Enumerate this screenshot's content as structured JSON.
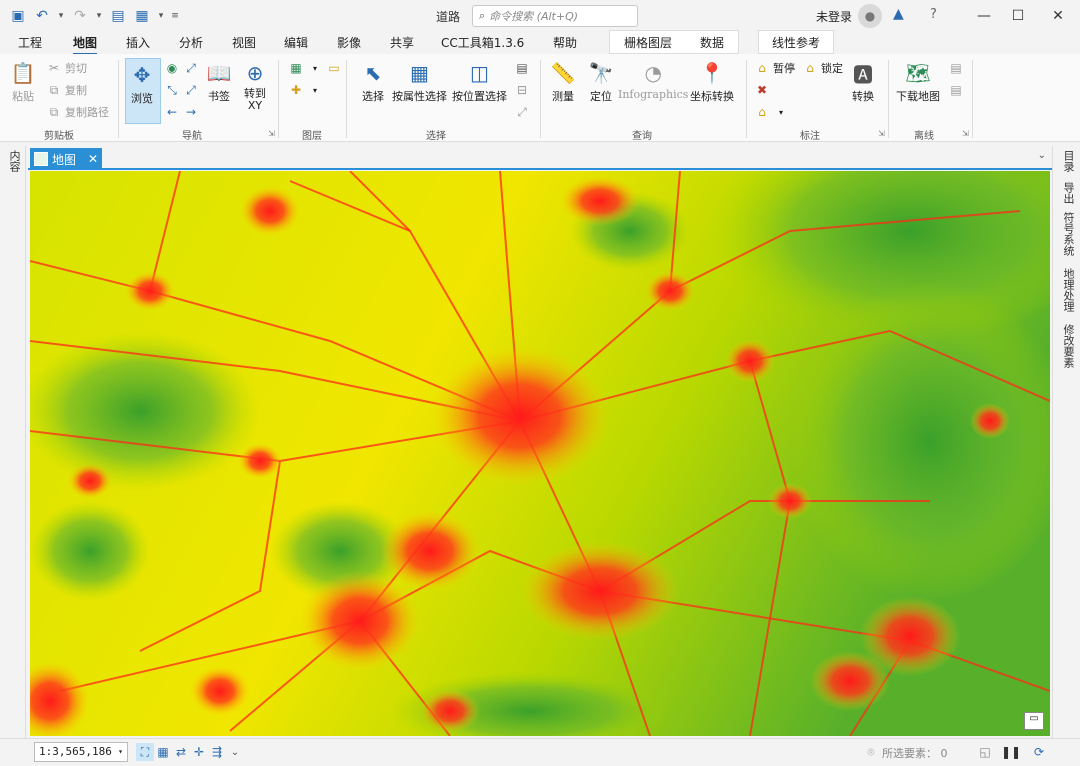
{
  "window": {
    "doc_title": "道路",
    "search_placeholder": "命令搜索 (Alt+Q)",
    "user_status": "未登录",
    "help": "?",
    "minimize": "—",
    "maximize": "☐",
    "close": "✕"
  },
  "tabs": [
    "工程",
    "地图",
    "插入",
    "分析",
    "视图",
    "编辑",
    "影像",
    "共享",
    "CC工具箱1.3.6",
    "帮助",
    "栅格图层",
    "数据",
    "线性参考"
  ],
  "ribbon": {
    "clipboard": {
      "paste": "粘贴",
      "cut": "剪切",
      "copy": "复制",
      "copy_path": "复制路径",
      "label": "剪贴板"
    },
    "navigate": {
      "browse": "浏览",
      "bookmark": "书签",
      "goto_xy": "转到\nXY",
      "label": "导航"
    },
    "layer": {
      "label": "图层"
    },
    "selection": {
      "select": "选择",
      "by_attr": "按属性选择",
      "by_loc": "按位置选择",
      "label": "选择"
    },
    "inquiry": {
      "measure": "测量",
      "locate": "定位",
      "infographics": "Infographics",
      "coord_convert": "坐标转换",
      "label": "查询"
    },
    "labeling": {
      "pause": "暂停",
      "lock": "锁定",
      "convert": "转换",
      "label": "标注"
    },
    "offline": {
      "download": "下载地图",
      "label": "离线"
    }
  },
  "left_panel": {
    "contents": "内容"
  },
  "map_tab": {
    "label": "地图"
  },
  "right_panel": [
    "目录",
    "导出",
    "符号系统",
    "地理处理",
    "修改要素"
  ],
  "status": {
    "scale": "1:3,565,186",
    "selected_label": "所选要素：",
    "selected_count": "0"
  }
}
